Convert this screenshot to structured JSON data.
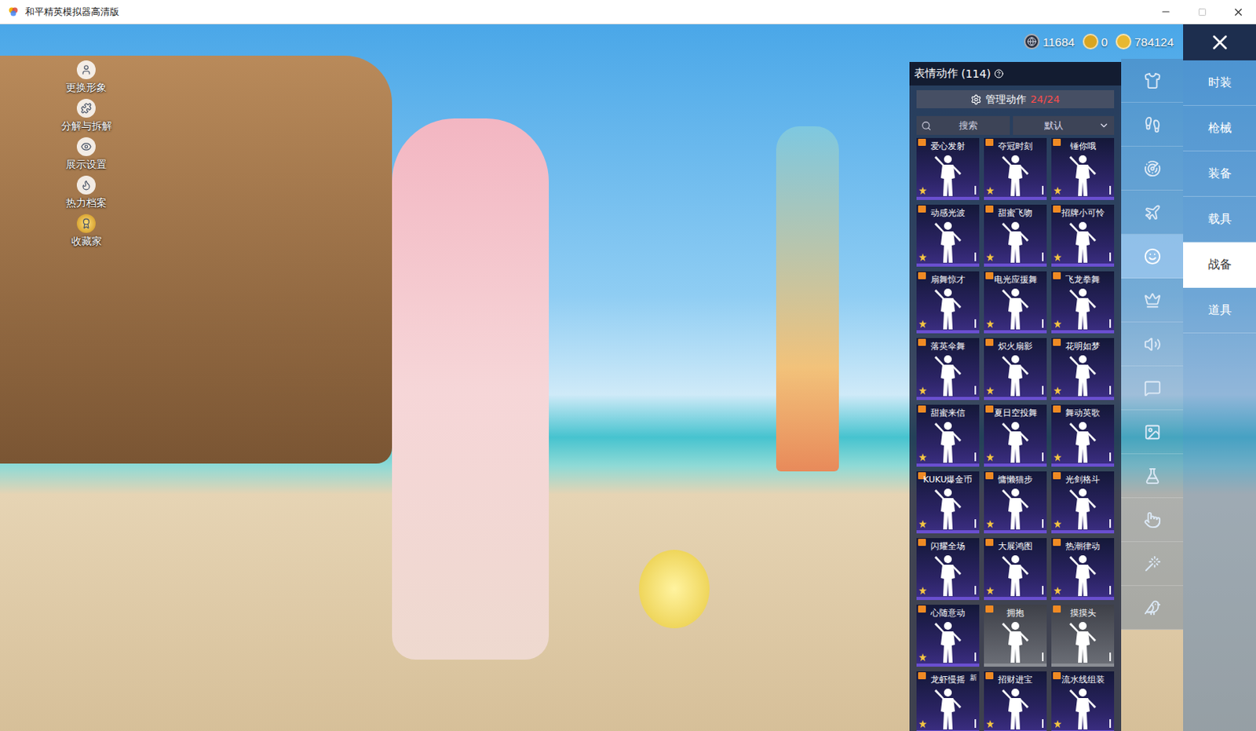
{
  "window": {
    "title": "和平精英模拟器高清版"
  },
  "side_menu": [
    {
      "label": "更换形象"
    },
    {
      "label": "分解与拆解"
    },
    {
      "label": "展示设置"
    },
    {
      "label": "热力档案"
    },
    {
      "label": "收藏家"
    }
  ],
  "currencies": [
    {
      "amount": "11684"
    },
    {
      "amount": "0"
    },
    {
      "amount": "784124"
    }
  ],
  "emote_panel": {
    "title": "表情动作",
    "count": "(114)",
    "new_label": "新"
  },
  "manage": {
    "label": "管理动作",
    "count": "24/24"
  },
  "search": {
    "placeholder": "搜索"
  },
  "sort": {
    "value": "默认"
  },
  "emotes": [
    {
      "name": "爱心发射",
      "kind": "premium",
      "new": false
    },
    {
      "name": "夺冠时刻",
      "kind": "premium",
      "new": false
    },
    {
      "name": "锤你哦",
      "kind": "premium",
      "new": false
    },
    {
      "name": "动感光波",
      "kind": "premium",
      "new": false
    },
    {
      "name": "甜蜜飞吻",
      "kind": "premium",
      "new": false
    },
    {
      "name": "招牌小可怜",
      "kind": "premium",
      "new": false
    },
    {
      "name": "扇舞惊才",
      "kind": "premium",
      "new": false
    },
    {
      "name": "电光应援舞",
      "kind": "premium",
      "new": false
    },
    {
      "name": "飞龙拳舞",
      "kind": "premium",
      "new": false
    },
    {
      "name": "落英伞舞",
      "kind": "premium",
      "new": false
    },
    {
      "name": "炽火扇影",
      "kind": "premium",
      "new": false
    },
    {
      "name": "花明如梦",
      "kind": "premium",
      "new": false
    },
    {
      "name": "甜蜜来信",
      "kind": "premium",
      "new": false
    },
    {
      "name": "夏日空投舞",
      "kind": "premium",
      "new": false
    },
    {
      "name": "舞动英歌",
      "kind": "premium",
      "new": false
    },
    {
      "name": "KUKU爆金币",
      "kind": "premium",
      "new": false
    },
    {
      "name": "慵懒猫步",
      "kind": "premium",
      "new": false
    },
    {
      "name": "光剑格斗",
      "kind": "premium",
      "new": false
    },
    {
      "name": "闪耀全场",
      "kind": "premium",
      "new": false
    },
    {
      "name": "大展鸿图",
      "kind": "premium",
      "new": false
    },
    {
      "name": "热潮律动",
      "kind": "premium",
      "new": false
    },
    {
      "name": "心随意动",
      "kind": "premium",
      "new": false
    },
    {
      "name": "拥抱",
      "kind": "basic",
      "new": false
    },
    {
      "name": "摸摸头",
      "kind": "basic",
      "new": false
    },
    {
      "name": "龙虾慢摇",
      "kind": "premium",
      "new": true
    },
    {
      "name": "招财进宝",
      "kind": "premium",
      "new": false
    },
    {
      "name": "流水线组装",
      "kind": "premium",
      "new": false
    }
  ],
  "category_rail": [
    {
      "selected": false
    },
    {
      "selected": false
    },
    {
      "selected": false
    },
    {
      "selected": false
    },
    {
      "selected": true
    },
    {
      "selected": false
    },
    {
      "selected": false
    },
    {
      "selected": false
    },
    {
      "selected": false
    },
    {
      "selected": false
    },
    {
      "selected": false
    },
    {
      "selected": false
    },
    {
      "selected": false
    }
  ],
  "tabs": [
    {
      "label": "时装",
      "selected": false
    },
    {
      "label": "枪械",
      "selected": false
    },
    {
      "label": "装备",
      "selected": false
    },
    {
      "label": "载具",
      "selected": false
    },
    {
      "label": "战备",
      "selected": true
    },
    {
      "label": "道具",
      "selected": false
    }
  ]
}
